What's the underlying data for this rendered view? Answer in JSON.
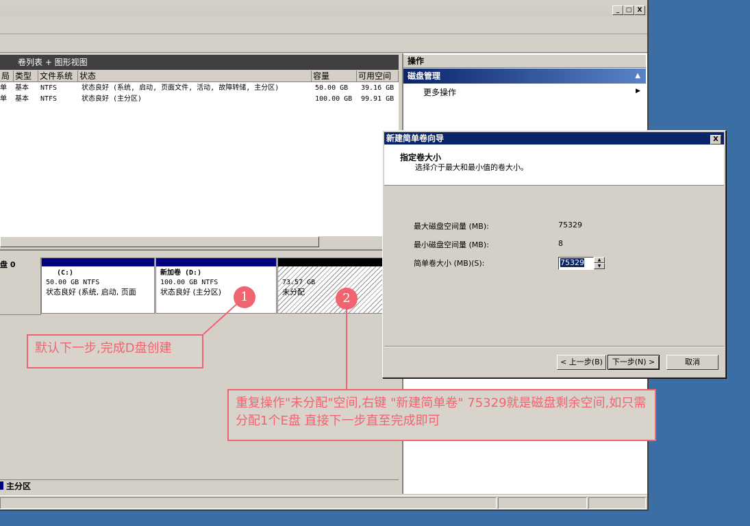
{
  "window": {
    "min_btn": "_",
    "max_btn": "□",
    "close_btn": "X"
  },
  "list_view": {
    "title": "卷列表 + 图形视图",
    "columns": [
      "局",
      "类型",
      "文件系统",
      "状态",
      "容量",
      "可用空间"
    ],
    "rows": [
      {
        "layout": "单",
        "type": "基本",
        "fs": "NTFS",
        "status": "状态良好 (系统, 启动, 页面文件, 活动, 故障转储, 主分区)",
        "capacity": "50.00 GB",
        "free": "39.16 GB"
      },
      {
        "layout": "单",
        "type": "基本",
        "fs": "NTFS",
        "status": "状态良好 (主分区)",
        "capacity": "100.00 GB",
        "free": "99.91 GB"
      }
    ]
  },
  "graph_view": {
    "disk_label": "盘 0",
    "partitions": [
      {
        "name": "(C:)",
        "size": "50.00 GB NTFS",
        "status": "状态良好 (系统, 启动, 页面"
      },
      {
        "name": "新加卷  (D:)",
        "size": "100.00 GB NTFS",
        "status": "状态良好 (主分区)"
      },
      {
        "name": "",
        "size": "73.57 GB",
        "status": "未分配"
      }
    ],
    "legend": "主分区"
  },
  "actions": {
    "title": "操作",
    "group": "磁盘管理",
    "more": "更多操作",
    "collapse_glyph": "▲",
    "more_glyph": "▶"
  },
  "dialog": {
    "title": "新建简单卷向导",
    "close": "X",
    "heading": "指定卷大小",
    "subheading": "选择介于最大和最小值的卷大小。",
    "max_label": "最大磁盘空间量 (MB):",
    "max_value": "75329",
    "min_label": "最小磁盘空间量 (MB):",
    "min_value": "8",
    "size_label": "简单卷大小 (MB)(S):",
    "size_value": "75329",
    "back": "< 上一步(B)",
    "next": "下一步(N) >",
    "cancel": "取消"
  },
  "annotations": {
    "marker1": "1",
    "marker2": "2",
    "note1": "默认下一步,完成D盘创建",
    "note2": "重复操作\"未分配\"空间,右键 \"新建简单卷\" 75329就是磁盘剩余空间,如只需分配1个E盘 直接下一步直至完成即可",
    "color": "#f06470"
  }
}
